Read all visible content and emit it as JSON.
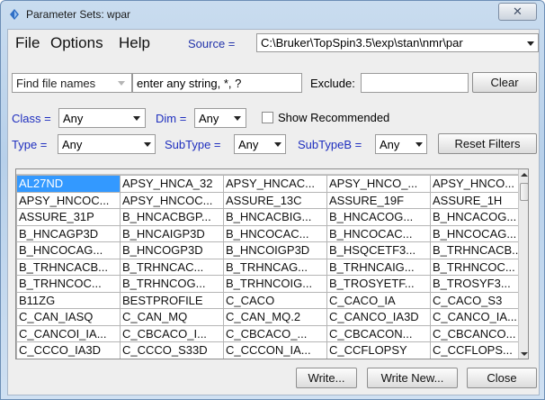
{
  "window": {
    "title": "Parameter Sets: wpar",
    "close_glyph": "✕"
  },
  "menu": {
    "file": "File",
    "options": "Options",
    "help": "Help"
  },
  "source": {
    "label": "Source =",
    "value": "C:\\Bruker\\TopSpin3.5\\exp\\stan\\nmr\\par"
  },
  "search": {
    "mode": "Find file names",
    "placeholder": "enter any string, *, ?",
    "exclude_label": "Exclude:",
    "exclude_value": "",
    "clear": "Clear"
  },
  "filters": {
    "class_label": "Class =",
    "class_value": "Any",
    "dim_label": "Dim =",
    "dim_value": "Any",
    "show_recommended": "Show Recommended",
    "show_recommended_checked": false,
    "type_label": "Type =",
    "type_value": "Any",
    "subtype_label": "SubType =",
    "subtype_value": "Any",
    "subtypeb_label": "SubTypeB =",
    "subtypeb_value": "Any",
    "reset": "Reset Filters"
  },
  "table": {
    "rows": [
      [
        "AL27ND",
        "APSY_HNCA_32",
        "APSY_HNCAC...",
        "APSY_HNCO_...",
        "APSY_HNCO..."
      ],
      [
        "APSY_HNCOC...",
        "APSY_HNCOC...",
        "ASSURE_13C",
        "ASSURE_19F",
        "ASSURE_1H"
      ],
      [
        "ASSURE_31P",
        "B_HNCACBGP...",
        "B_HNCACBIG...",
        "B_HNCACOG...",
        "B_HNCACOG..."
      ],
      [
        "B_HNCAGP3D",
        "B_HNCAIGP3D",
        "B_HNCOCAC...",
        "B_HNCOCAC...",
        "B_HNCOCAG..."
      ],
      [
        "B_HNCOCAG...",
        "B_HNCOGP3D",
        "B_HNCOIGP3D",
        "B_HSQCETF3...",
        "B_TRHNCACB..."
      ],
      [
        "B_TRHNCACB...",
        "B_TRHNCAC...",
        "B_TRHNCAG...",
        "B_TRHNCAIG...",
        "B_TRHNCOC..."
      ],
      [
        "B_TRHNCOC...",
        "B_TRHNCOG...",
        "B_TRHNCOIG...",
        "B_TROSYETF...",
        "B_TROSYF3..."
      ],
      [
        "B11ZG",
        "BESTPROFILE",
        "C_CACO",
        "C_CACO_IA",
        "C_CACO_S3"
      ],
      [
        "C_CAN_IASQ",
        "C_CAN_MQ",
        "C_CAN_MQ.2",
        "C_CANCO_IA3D",
        "C_CANCO_IA..."
      ],
      [
        "C_CANCOI_IA...",
        "C_CBCACO_I...",
        "C_CBCACO_...",
        "C_CBCACON...",
        "C_CBCANCO..."
      ],
      [
        "C_CCCO_IA3D",
        "C_CCCO_S33D",
        "C_CCCON_IA...",
        "C_CCFLOPSY",
        "C_CCFLOPS..."
      ]
    ],
    "selected": "AL27ND"
  },
  "footer": {
    "write": "Write...",
    "write_new": "Write New...",
    "close": "Close"
  },
  "colors": {
    "selection": "#3399ff",
    "filter_label": "#1f2fbf"
  }
}
